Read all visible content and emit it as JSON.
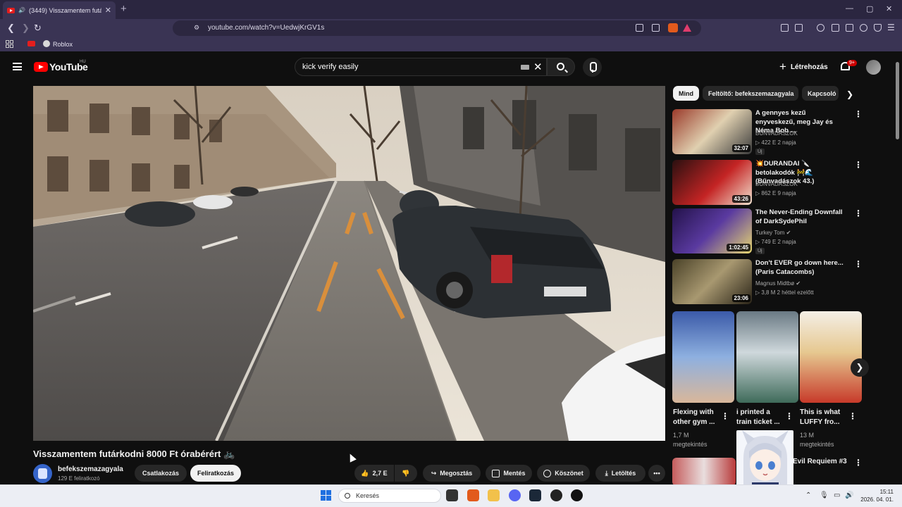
{
  "browser": {
    "tab_title": "(3449) Visszamentem futárk...",
    "url": "youtube.com/watch?v=UedwjKrGV1s",
    "bookmark": "Roblox",
    "new_tab": "+",
    "minimize": "—",
    "maximize": "▢",
    "close": "✕"
  },
  "header": {
    "logo": "YouTube",
    "region": "HU",
    "search_query": "kick verify easily",
    "create_label": "Létrehozás",
    "notifications": "9+"
  },
  "video": {
    "title": "Visszamentem futárkodni 8000 Ft órabérért 🚲",
    "channel": "befekszemazagyala",
    "subscribers": "129 E feliratkozó",
    "join_label": "Csatlakozás",
    "subscribe_label": "Feliratkozás",
    "likes": "2,7 E",
    "share_label": "Megosztás",
    "save_label": "Mentés",
    "thanks_label": "Köszönet",
    "download_label": "Letöltés"
  },
  "chips": [
    "Mind",
    "Feltöltő: befekszemazagyala",
    "Kapcsoló"
  ],
  "recommendations": [
    {
      "title": "A gennyes kezű enyveskezű, meg Jay és Néma Bob ...",
      "channel": "BŰNVADÁSZOK",
      "meta": "▷ 422 E  2 napja",
      "new": "Új",
      "duration": "32:07"
    },
    {
      "title": "💥DURANDAI 🔪betolakodók 🚧🌊(Bűnvadászok 43.)",
      "channel": "BŰNVADÁSZOK",
      "meta": "▷ 862 E  9 napja",
      "new": "",
      "duration": "43:26"
    },
    {
      "title": "The Never-Ending Downfall of DarkSydePhil",
      "channel": "Turkey Tom ✔",
      "meta": "▷ 749 E  2 napja",
      "new": "Új",
      "duration": "1:02:45"
    },
    {
      "title": "Don't EVER go down here... (Paris Catacombs)",
      "channel": "Magnus Midtbø ✔",
      "meta": "▷ 3,8 M  2 héttel ezelőtt",
      "new": "",
      "duration": "23:06"
    }
  ],
  "shorts": [
    {
      "title_line1": "Flexing with",
      "title_line2": "other gym ...",
      "views": "1,7 M",
      "views_label": "megtekintés"
    },
    {
      "title_line1": "i printed a",
      "title_line2": "train ticket ...",
      "views": "",
      "views_label": ""
    },
    {
      "title_line1": "This is what",
      "title_line2": "LUFFY fro...",
      "views": "13 M",
      "views_label": "megtekintés"
    }
  ],
  "next_rec_title": "Evil Requiem #3",
  "taskbar": {
    "search_placeholder": "Keresés",
    "time": "15:11",
    "date": "2026. 04. 01."
  }
}
